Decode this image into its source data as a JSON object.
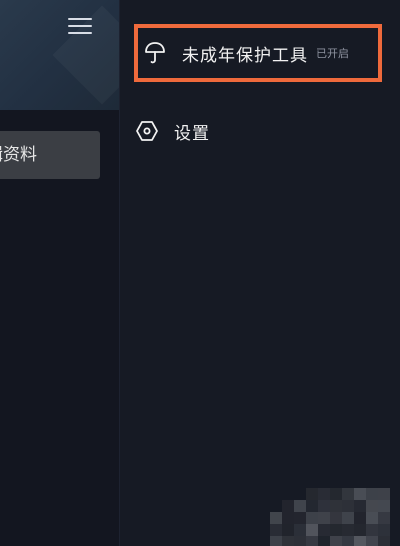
{
  "left_pane": {
    "edit_profile_label": "辑资料",
    "menu_icon": "hamburger-menu-icon"
  },
  "drawer": {
    "items": [
      {
        "label": "未成年保护工具",
        "badge": "已开启",
        "icon": "umbrella-icon",
        "highlight_color": "#ef6a3c"
      },
      {
        "label": "设置",
        "icon": "hexagon-gear-icon"
      }
    ]
  },
  "colors": {
    "background": "#161a24",
    "highlight_border": "#ef6a3c",
    "text": "#f2f2f2",
    "badge_text": "#8e93a0"
  }
}
